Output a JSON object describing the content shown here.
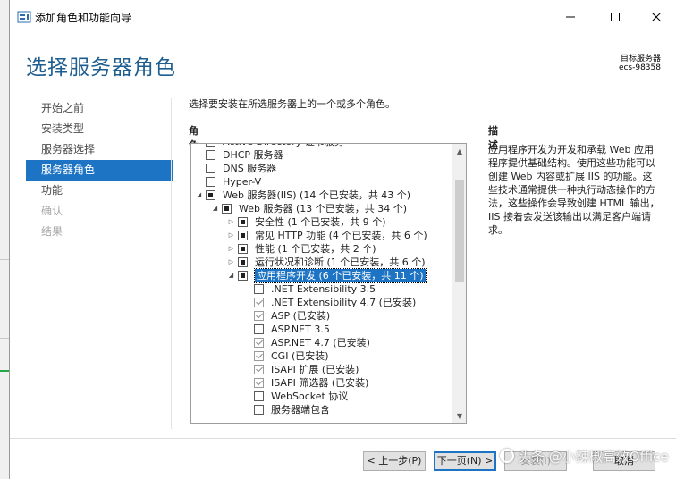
{
  "window": {
    "title": "添加角色和功能向导"
  },
  "header": {
    "page_title": "选择服务器角色",
    "target_label": "目标服务器",
    "target_name": "ecs-98358"
  },
  "nav": {
    "items": [
      {
        "label": "开始之前",
        "state": "normal"
      },
      {
        "label": "安装类型",
        "state": "normal"
      },
      {
        "label": "服务器选择",
        "state": "normal"
      },
      {
        "label": "服务器角色",
        "state": "active"
      },
      {
        "label": "功能",
        "state": "normal"
      },
      {
        "label": "确认",
        "state": "disabled"
      },
      {
        "label": "结果",
        "state": "disabled"
      }
    ]
  },
  "main": {
    "instruction": "选择要安装在所选服务器上的一个或多个角色。",
    "roles_heading": "角色",
    "description_heading": "描述",
    "description_text": "应用程序开发为开发和承载 Web 应用程序提供基础结构。使用这些功能可以创建 Web 内容或扩展 IIS 的功能。这些技术通常提供一种执行动态操作的方法，这些操作会导致创建 HTML 输出，IIS 接着会发送该输出以满足客户端请求。"
  },
  "roles": [
    {
      "label": "Active Directory 证书服务",
      "level": 0,
      "check": "unchecked",
      "expander": "none",
      "clipped": "top"
    },
    {
      "label": "DHCP 服务器",
      "level": 0,
      "check": "unchecked",
      "expander": "none"
    },
    {
      "label": "DNS 服务器",
      "level": 0,
      "check": "unchecked",
      "expander": "none"
    },
    {
      "label": "Hyper-V",
      "level": 0,
      "check": "unchecked",
      "expander": "none"
    },
    {
      "label": "Web 服务器(IIS) (14 个已安装，共 43 个)",
      "level": 0,
      "check": "partial",
      "expander": "expanded"
    },
    {
      "label": "Web 服务器 (13 个已安装，共 34 个)",
      "level": 1,
      "check": "partial",
      "expander": "expanded"
    },
    {
      "label": "安全性 (1 个已安装，共 9 个)",
      "level": 2,
      "check": "partial",
      "expander": "collapsed"
    },
    {
      "label": "常见 HTTP 功能 (4 个已安装，共 6 个)",
      "level": 2,
      "check": "partial",
      "expander": "collapsed"
    },
    {
      "label": "性能 (1 个已安装，共 2 个)",
      "level": 2,
      "check": "partial",
      "expander": "collapsed"
    },
    {
      "label": "运行状况和诊断 (1 个已安装，共 6 个)",
      "level": 2,
      "check": "partial",
      "expander": "collapsed"
    },
    {
      "label": "应用程序开发 (6 个已安装，共 11 个)",
      "level": 2,
      "check": "partial",
      "expander": "expanded",
      "selected": true
    },
    {
      "label": ".NET Extensibility 3.5",
      "level": 3,
      "check": "unchecked",
      "expander": "none"
    },
    {
      "label": ".NET Extensibility 4.7 (已安装)",
      "level": 3,
      "check": "checked",
      "expander": "none"
    },
    {
      "label": "ASP (已安装)",
      "level": 3,
      "check": "checked",
      "expander": "none"
    },
    {
      "label": "ASP.NET 3.5",
      "level": 3,
      "check": "unchecked",
      "expander": "none"
    },
    {
      "label": "ASP.NET 4.7 (已安装)",
      "level": 3,
      "check": "checked",
      "expander": "none"
    },
    {
      "label": "CGI (已安装)",
      "level": 3,
      "check": "checked",
      "expander": "none"
    },
    {
      "label": "ISAPI 扩展 (已安装)",
      "level": 3,
      "check": "checked",
      "expander": "none"
    },
    {
      "label": "ISAPI 筛选器 (已安装)",
      "level": 3,
      "check": "checked",
      "expander": "none"
    },
    {
      "label": "WebSocket 协议",
      "level": 3,
      "check": "unchecked",
      "expander": "none"
    },
    {
      "label": "服务器端包含",
      "level": 3,
      "check": "unchecked",
      "expander": "none",
      "clipped": "bottom"
    }
  ],
  "footer": {
    "prev_label": "< 上一步(P)",
    "next_label": "下一页(N) >",
    "install_label": "安装(I)",
    "cancel_label": "取消"
  },
  "watermark": {
    "text": "头条 @小辣椒高效Office"
  },
  "colors": {
    "accent": "#1e74c4",
    "title_blue": "#1d5d8f",
    "disabled_text": "#a8a8a8"
  }
}
